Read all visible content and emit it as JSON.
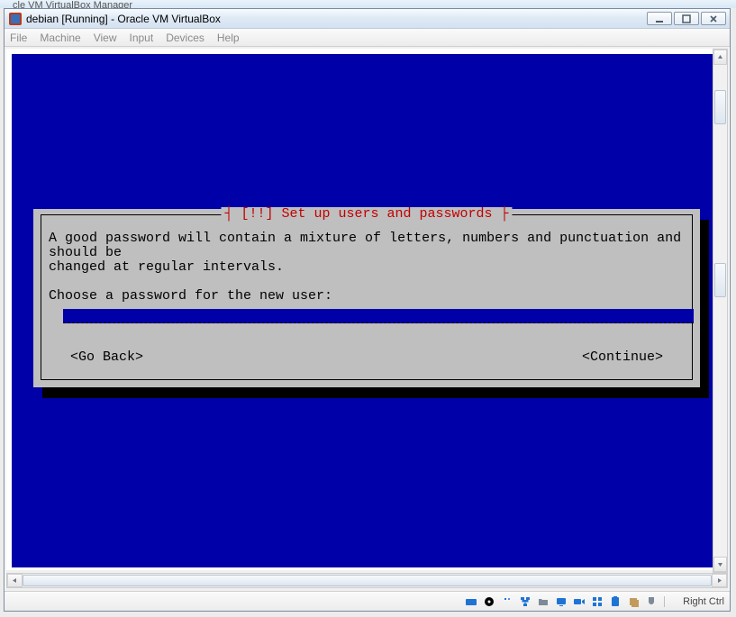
{
  "parent_window_title": "cle VM VirtualBox Manager",
  "window": {
    "title": "debian [Running] - Oracle VM VirtualBox"
  },
  "menu": {
    "file": "File",
    "machine": "Machine",
    "view": "View",
    "input": "Input",
    "devices": "Devices",
    "help": "Help"
  },
  "dialog": {
    "title_decor_left": "┤ ",
    "title": "[!!] Set up users and passwords",
    "title_decor_right": " ├",
    "body_line1": "A good password will contain a mixture of letters, numbers and punctuation and should be",
    "body_line2": "changed at regular intervals.",
    "body_line3": "",
    "body_line4": "Choose a password for the new user:",
    "password_value": "",
    "go_back": "<Go Back>",
    "continue": "<Continue>"
  },
  "status": {
    "host_key": "Right Ctrl"
  }
}
